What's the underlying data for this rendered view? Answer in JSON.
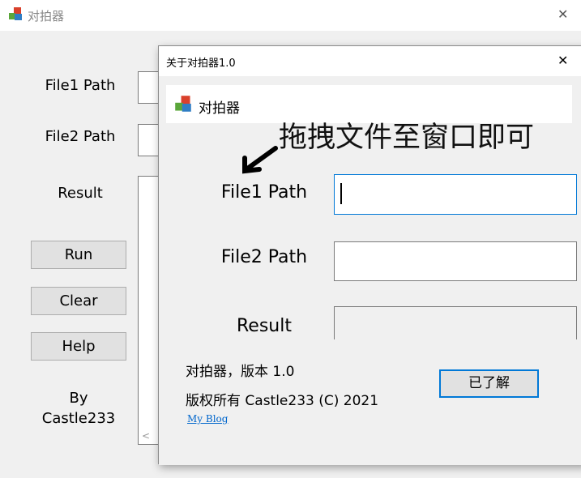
{
  "main_window": {
    "title": "对拍器",
    "file1_label": "File1 Path",
    "file2_label": "File2 Path",
    "result_label": "Result",
    "run": "Run",
    "clear": "Clear",
    "help": "Help",
    "by": "By",
    "author": "Castle233",
    "close": "✕",
    "scroll_left": "<"
  },
  "about_dialog": {
    "title": "关于对拍器1.0",
    "close": "✕",
    "banner_title": "对拍器",
    "hint": "拖拽文件至窗口即可",
    "file1_label": "File1 Path",
    "file2_label": "File2 Path",
    "result_label": "Result",
    "version": "对拍器，版本 1.0",
    "copyright": "版权所有 Castle233 (C) 2021",
    "link": "My Blog",
    "ok": "已了解"
  },
  "colors": {
    "accent": "#0078d7",
    "link": "#0066cc"
  }
}
